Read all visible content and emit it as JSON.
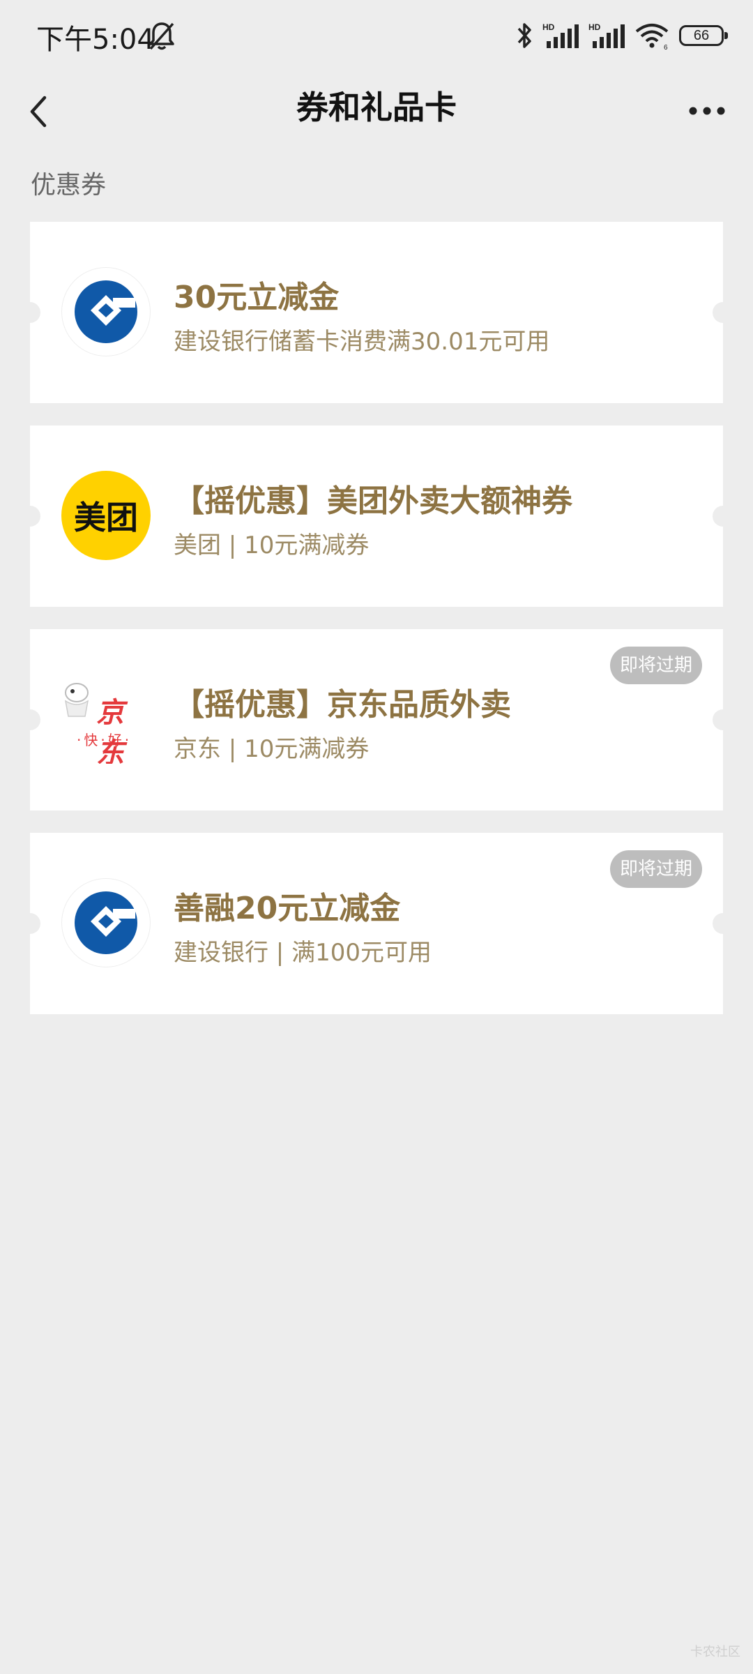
{
  "status_bar": {
    "time": "下午5:04",
    "battery": "66"
  },
  "nav": {
    "title": "券和礼品卡"
  },
  "section": {
    "label": "优惠券"
  },
  "coupons": [
    {
      "title": "30元立减金",
      "subtitle": "建设银行储蓄卡消费满30.01元可用",
      "logo": "ccb-logo",
      "badge": ""
    },
    {
      "title": "【摇优惠】美团外卖大额神券",
      "subtitle": "美团 | 10元满减券",
      "logo": "meituan-logo",
      "logo_text": "美团",
      "badge": ""
    },
    {
      "title": "【摇优惠】京东品质外卖",
      "subtitle": "京东 | 10元满减券",
      "logo": "jd-logo",
      "logo_text": "京东",
      "logo_subtext": "·快·好·",
      "badge": "即将过期"
    },
    {
      "title": "善融20元立减金",
      "subtitle": "建设银行 | 满100元可用",
      "logo": "ccb-logo",
      "badge": "即将过期"
    }
  ],
  "watermark": "卡农社区",
  "colors": {
    "background": "#ededed",
    "card": "#ffffff",
    "title_gold": "#8d7342",
    "subtitle_gold": "#9c8a64",
    "badge_gray": "#bdbdbd",
    "ccb_blue": "#1059a8",
    "meituan_yellow": "#ffd100",
    "jd_red": "#e4393c"
  }
}
